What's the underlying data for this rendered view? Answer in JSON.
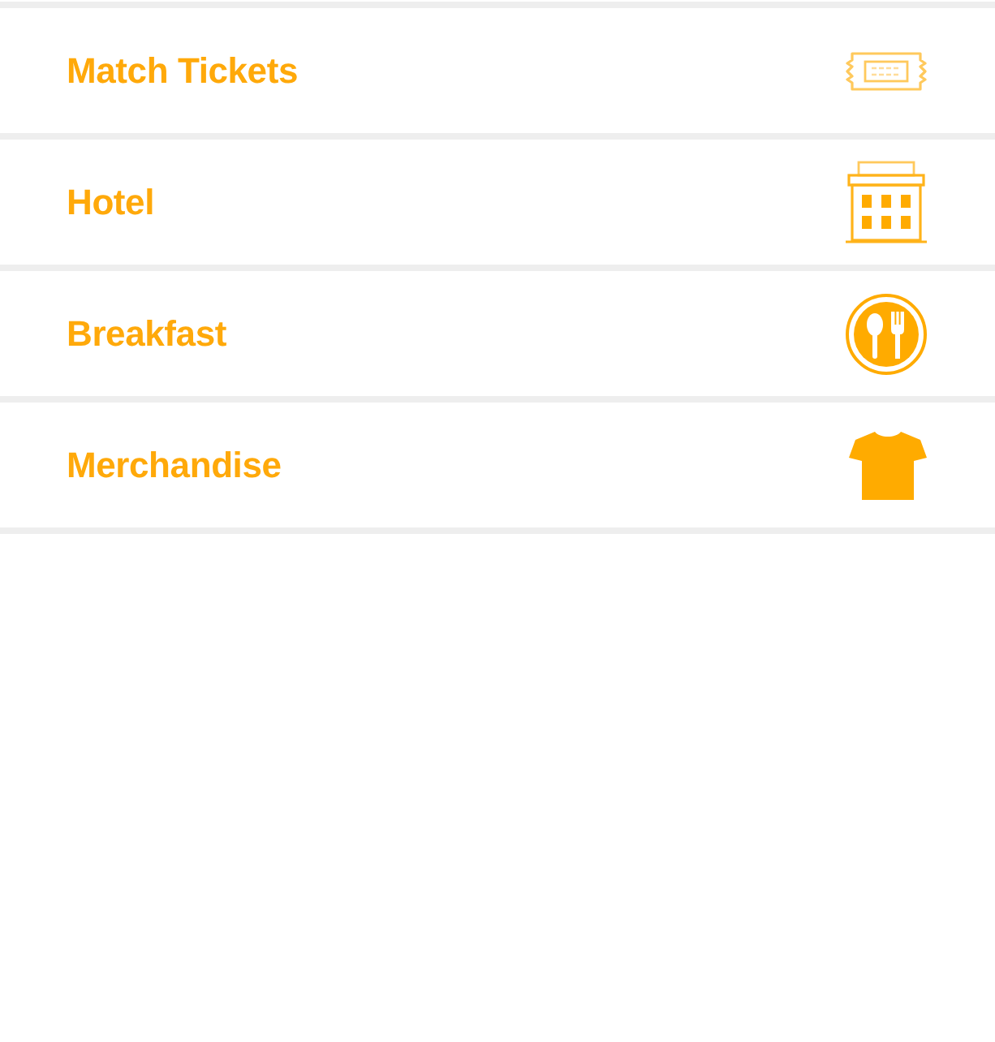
{
  "menu": {
    "items": [
      {
        "label": "Match Tickets",
        "kind": "ticket"
      },
      {
        "label": "Hotel",
        "kind": "hotel"
      },
      {
        "label": "Breakfast",
        "kind": "breakfast"
      },
      {
        "label": "Merchandise",
        "kind": "tshirt"
      }
    ]
  }
}
